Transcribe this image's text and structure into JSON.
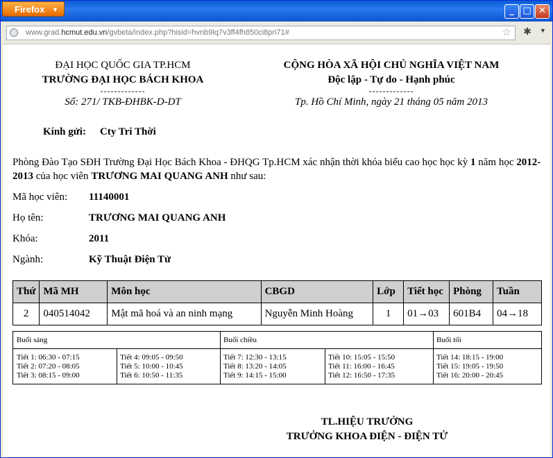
{
  "browser": {
    "menu_button_label": "Firefox",
    "url_prefix": "www.grad.",
    "url_domain": "hcmut.edu.vn",
    "url_path": "/gvbeta/index.php?hisid=hvnb9lq7v3ff4fh850ci8pri71#"
  },
  "header_left": {
    "line1": "ĐẠI HỌC QUỐC GIA TP.HCM",
    "line2": "TRƯỜNG ĐẠI HỌC BÁCH KHOA",
    "divider": "-------------",
    "number": "Số: 271/ TKB-ĐHBK-D-DT"
  },
  "header_right": {
    "line1": "CỘNG HÒA XÃ HỘI CHỦ NGHĨA VIỆT NAM",
    "line2": "Độc lập - Tự do - Hạnh phúc",
    "divider": "-------------",
    "date": "Tp. Hồ Chí Minh, ngày 21 tháng 05 năm 2013"
  },
  "recipient": {
    "label": "Kính gửi:",
    "value": "Cty Tri Thời"
  },
  "intro": {
    "part1": "Phòng Đào Tạo SĐH Trường Đại Học Bách Khoa - ĐHQG Tp.HCM xác nhận thời khóa biểu cao học học kỳ ",
    "semester": "1",
    "part2": " năm học ",
    "year": "2012-2013",
    "part3": " của học viên ",
    "student": "TRƯƠNG MAI QUANG ANH",
    "part4": " như sau:"
  },
  "info": [
    {
      "label": "Mã học viên:",
      "value": "11140001"
    },
    {
      "label": "Họ tên:",
      "value": "TRƯƠNG MAI QUANG ANH"
    },
    {
      "label": "Khóa:",
      "value": "2011"
    },
    {
      "label": "Ngành:",
      "value": "Kỹ Thuật Điện Tử"
    }
  ],
  "course_table": {
    "headers": [
      "Thứ",
      "Mã MH",
      "Môn học",
      "CBGD",
      "Lớp",
      "Tiết học",
      "Phòng",
      "Tuần"
    ],
    "row": [
      "2",
      "040514042",
      "Mật mã hoá và an ninh mạng",
      "Nguyễn Minh Hoàng",
      "1",
      "01→03",
      "601B4",
      "04→18"
    ]
  },
  "schedule": {
    "morning": "Buổi sáng",
    "afternoon": "Buổi chiều",
    "evening": "Buổi tối",
    "col1": [
      "Tiết 1: 06:30 - 07:15",
      "Tiết 2: 07:20 - 08:05",
      "Tiết 3: 08:15 - 09:00"
    ],
    "col2": [
      "Tiết 4: 09:05 - 09:50",
      "Tiết 5: 10:00 - 10:45",
      "Tiết 6: 10:50 - 11:35"
    ],
    "col3": [
      "Tiết 7: 12:30 - 13:15",
      "Tiết 8: 13:20 - 14:05",
      "Tiết 9: 14:15 - 15:00"
    ],
    "col4": [
      "Tiết 10: 15:05 - 15:50",
      "Tiết 11: 16:00 - 16:45",
      "Tiết 12: 16:50 - 17:35"
    ],
    "col5": [
      "Tiết 14: 18:15 - 19:00",
      "Tiết 15: 19:05 - 19:50",
      "Tiết 16: 20:00 - 20:45"
    ]
  },
  "signature": {
    "line1": "TL.HIỆU TRƯỞNG",
    "line2": "TRƯỞNG KHOA ĐIỆN - ĐIỆN TỬ"
  }
}
